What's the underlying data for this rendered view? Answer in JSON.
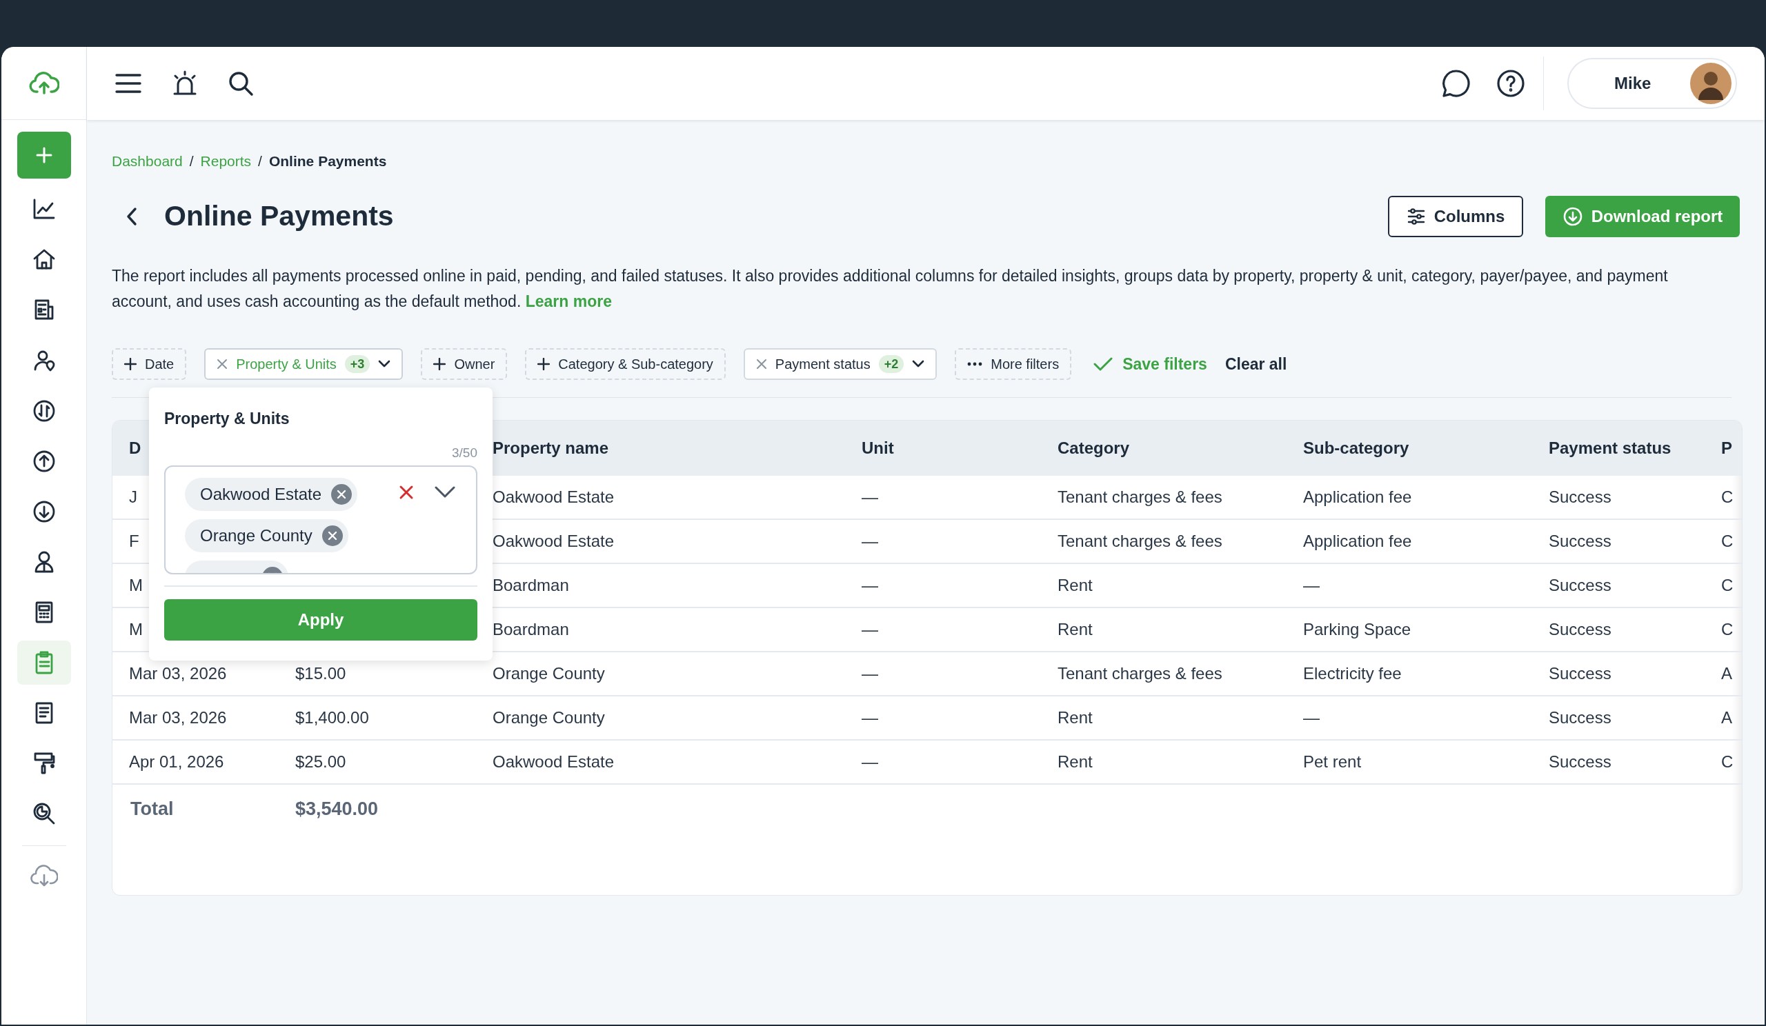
{
  "topbar": {
    "user_name": "Mike"
  },
  "sidebar": {
    "items": [
      {
        "selected": false
      },
      {
        "selected": false
      },
      {
        "selected": false
      },
      {
        "selected": false
      },
      {
        "selected": false
      },
      {
        "selected": false
      },
      {
        "selected": false
      },
      {
        "selected": false
      },
      {
        "selected": false
      },
      {
        "selected": true
      },
      {
        "selected": false
      },
      {
        "selected": false
      },
      {
        "selected": false
      }
    ]
  },
  "breadcrumb": [
    {
      "label": "Dashboard",
      "current": false
    },
    {
      "label": "Reports",
      "current": false
    },
    {
      "label": "Online Payments",
      "current": true
    }
  ],
  "breadcrumb_separator": "/",
  "title": "Online Payments",
  "buttons": {
    "columns": "Columns",
    "download": "Download report"
  },
  "description": "The report includes all payments processed online in paid, pending, and failed statuses. It also provides additional columns for detailed insights, groups data by property, property & unit, category, payer/payee, and payment account, and uses cash accounting as the default method.",
  "learn_more": "Learn more",
  "filters": [
    {
      "kind": "add",
      "label": "Date"
    },
    {
      "kind": "active",
      "label": "Property & Units",
      "count": "+3",
      "open": true
    },
    {
      "kind": "add",
      "label": "Owner"
    },
    {
      "kind": "add",
      "label": "Category & Sub-category"
    },
    {
      "kind": "active",
      "label": "Payment status",
      "count": "+2",
      "open": false
    },
    {
      "kind": "more",
      "label": "More filters"
    }
  ],
  "save_filters": "Save filters",
  "clear_all": "Clear all",
  "popup": {
    "title": "Property & Units",
    "counter": "3/50",
    "chips": [
      "Oakwood Estate",
      "Orange County"
    ],
    "more_chips_below": true,
    "apply": "Apply"
  },
  "table": {
    "columns": {
      "date": "D",
      "property_name": "Property name",
      "unit": "Unit",
      "category": "Category",
      "sub_category": "Sub-category",
      "payment_status": "Payment status",
      "column_8": "P"
    },
    "rows": [
      {
        "date": "J",
        "property_name": "Oakwood Estate",
        "unit": "—",
        "category": "Tenant charges & fees",
        "sub_category": "Application fee",
        "payment_status": "Success",
        "column_8": "C"
      },
      {
        "date": "F",
        "property_name": "Oakwood Estate",
        "unit": "—",
        "category": "Tenant charges & fees",
        "sub_category": "Application fee",
        "payment_status": "Success",
        "column_8": "C"
      },
      {
        "date": "M",
        "property_name": "Boardman",
        "unit": "—",
        "category": "Rent",
        "sub_category": "—",
        "payment_status": "Success",
        "column_8": "C"
      },
      {
        "date": "M",
        "property_name": "Boardman",
        "unit": "—",
        "category": "Rent",
        "sub_category": "Parking Space",
        "payment_status": "Success",
        "column_8": "C"
      },
      {
        "date": "Mar 03, 2026",
        "amount": "$15.00",
        "property_name": "Orange County",
        "unit": "—",
        "category": "Tenant charges & fees",
        "sub_category": "Electricity fee",
        "payment_status": "Success",
        "column_8": "A"
      },
      {
        "date": "Mar 03, 2026",
        "amount": "$1,400.00",
        "property_name": "Orange County",
        "unit": "—",
        "category": "Rent",
        "sub_category": "—",
        "payment_status": "Success",
        "column_8": "A"
      },
      {
        "date": "Apr 01, 2026",
        "amount": "$25.00",
        "property_name": "Oakwood Estate",
        "unit": "—",
        "category": "Rent",
        "sub_category": "Pet rent",
        "payment_status": "Success",
        "column_8": "C"
      }
    ],
    "total": {
      "label": "Total",
      "amount": "$3,540.00"
    }
  }
}
